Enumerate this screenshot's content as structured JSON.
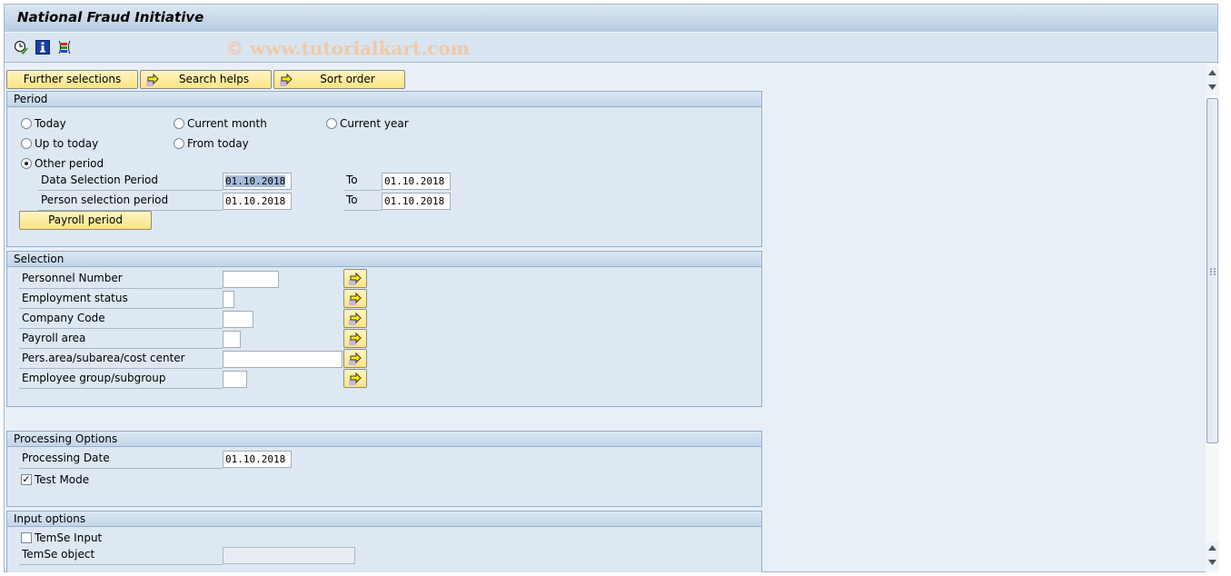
{
  "window": {
    "title": "National Fraud Initiative",
    "watermark": "© www.tutorialkart.com"
  },
  "toolbar": {
    "icons": [
      "execute-clock-icon",
      "info-icon",
      "variant-list-icon"
    ]
  },
  "action_buttons": {
    "further_selections": "Further selections",
    "search_helps": "Search helps",
    "sort_order": "Sort order"
  },
  "period": {
    "header": "Period",
    "options": {
      "today": "Today",
      "current_month": "Current month",
      "current_year": "Current year",
      "up_to_today": "Up to today",
      "from_today": "From today",
      "other_period": "Other period"
    },
    "selected_option": "Other period",
    "data_selection_label": "Data Selection Period",
    "data_selection_from": "01.10.2018",
    "data_selection_to": "01.10.2018",
    "person_selection_label": "Person selection period",
    "person_selection_from": "01.10.2018",
    "person_selection_to": "01.10.2018",
    "to_label": "To",
    "payroll_period_button": "Payroll period"
  },
  "selection": {
    "header": "Selection",
    "fields": [
      {
        "label": "Personnel Number",
        "value": ""
      },
      {
        "label": "Employment status",
        "value": ""
      },
      {
        "label": "Company Code",
        "value": ""
      },
      {
        "label": "Payroll area",
        "value": ""
      },
      {
        "label": "Pers.area/subarea/cost center",
        "value": ""
      },
      {
        "label": "Employee group/subgroup",
        "value": ""
      }
    ]
  },
  "processing_options": {
    "header": "Processing Options",
    "processing_date_label": "Processing Date",
    "processing_date": "01.10.2018",
    "test_mode_label": "Test Mode",
    "test_mode_checked": true
  },
  "input_options": {
    "header": "Input options",
    "temse_input_label": "TemSe Input",
    "temse_input_checked": false,
    "temse_object_label": "TemSe object",
    "temse_object_value": ""
  },
  "colors": {
    "button_yellow": "#fbe482",
    "group_header": "#c3d6ea",
    "background": "#e8eff7",
    "watermark": "#f2c9a6"
  }
}
